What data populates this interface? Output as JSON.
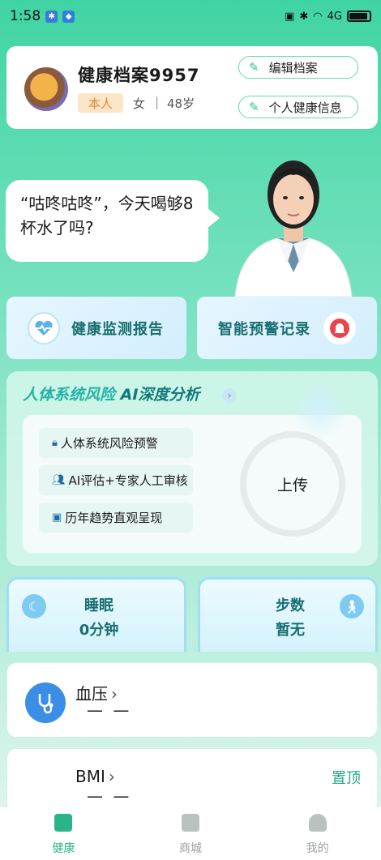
{
  "status": {
    "time": "1:58",
    "right_text": "4G"
  },
  "profile": {
    "name": "健康档案9957",
    "tag": "本人",
    "gender": "女",
    "separator": "|",
    "age": "48岁",
    "edit_label": "编辑档案",
    "info_label": "个人健康信息"
  },
  "speech": {
    "text": "“咕咚咕咚”，今天喝够8杯水了吗?"
  },
  "features": {
    "report_label": "健康监测报告",
    "warning_label": "智能预警记录"
  },
  "risk": {
    "title_a": "人体系统风险",
    "title_b": "AI深度分析",
    "arrow": "›",
    "items": [
      "人体系统风险预警",
      "AI评估+专家人工审核",
      "历年趋势直观呈现"
    ],
    "upload_label": "上传"
  },
  "sleep": {
    "label": "睡眠",
    "value": "0分钟"
  },
  "steps": {
    "label": "步数",
    "value": "暂无"
  },
  "blood_pressure": {
    "label": "血压",
    "chevron": "›",
    "value": "— —"
  },
  "bmi": {
    "label": "BMI",
    "chevron": "›",
    "value": "— —",
    "pin_label": "置顶"
  },
  "nav": {
    "items": [
      {
        "label": "健康",
        "active": true
      },
      {
        "label": "商城",
        "active": false
      },
      {
        "label": "我的",
        "active": false
      }
    ]
  },
  "colors": {
    "accent": "#24a884",
    "nav_active": "#2bb38a",
    "nav_inactive": "#9aa3a0"
  }
}
